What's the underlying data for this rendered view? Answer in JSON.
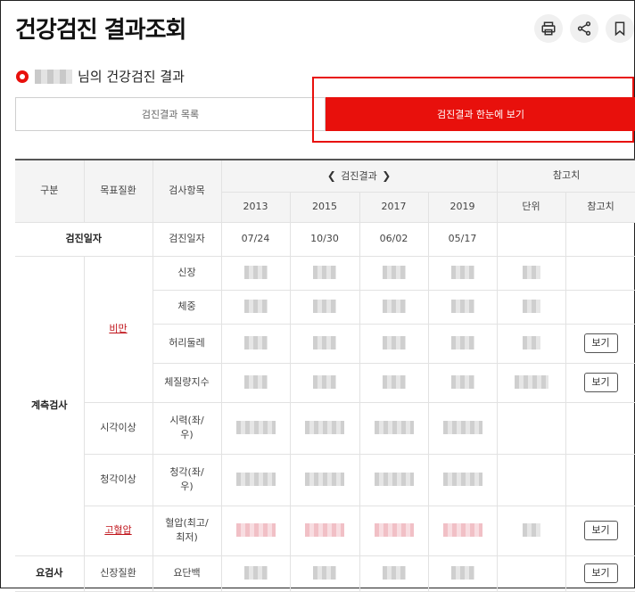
{
  "page": {
    "title": "건강검진 결과조회"
  },
  "header": {
    "actions": [
      {
        "name": "print",
        "icon": "printer-icon"
      },
      {
        "name": "share",
        "icon": "share-icon"
      },
      {
        "name": "bookmark",
        "icon": "bookmark-icon"
      }
    ]
  },
  "subtitle": {
    "suffix": "님의 건강검진 결과",
    "icon": "record-dot-icon",
    "accent": "#e8100c"
  },
  "tabs": [
    {
      "label": "검진결과 목록",
      "active": false
    },
    {
      "label": "검진결과 한눈에 보기",
      "active": true
    }
  ],
  "table": {
    "headers": {
      "category": "구분",
      "target_disease": "목표질환",
      "test_item": "검사항목",
      "results_group": "검진결과",
      "reference_group": "참고치",
      "unit": "단위",
      "reference": "참고치"
    },
    "years": [
      "2013",
      "2015",
      "2017",
      "2019"
    ],
    "exam_date": {
      "category": "검진일자",
      "item": "검진일자",
      "dates": [
        "07/24",
        "10/30",
        "06/02",
        "05/17"
      ]
    },
    "groups": {
      "measurement": "계측검사",
      "urine": "요검사",
      "obesity": "비만",
      "vision": "시각이상",
      "hearing": "청각이상",
      "hypertension": "고혈압",
      "kidney": "신장질환"
    },
    "items": {
      "height": "신장",
      "weight": "체중",
      "waist": "허리둘레",
      "bmi": "체질량지수",
      "vision_line1": "시력(좌/",
      "vision_line2": "우)",
      "hearing_line1": "청각(좌/",
      "hearing_line2": "우)",
      "bp_line1": "혈압(최고/",
      "bp_line2": "최저)",
      "protein": "요단백"
    },
    "view_label": "보기"
  }
}
